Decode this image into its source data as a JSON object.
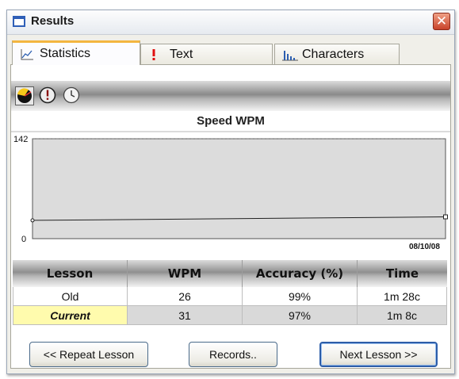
{
  "window": {
    "title": "Results",
    "close_glyph": "✕"
  },
  "tabs": [
    {
      "label": "Statistics",
      "icon": "line-chart-icon",
      "active": true
    },
    {
      "label": "Text",
      "icon": "exclamation-icon",
      "active": false
    },
    {
      "label": "Characters",
      "icon": "bar-chart-icon",
      "active": false
    }
  ],
  "toolbar": [
    {
      "icon": "speed-gauge-icon",
      "active": true
    },
    {
      "icon": "accuracy-warning-icon",
      "active": false
    },
    {
      "icon": "clock-icon",
      "active": false
    }
  ],
  "chart_data": {
    "type": "line",
    "title": "Speed WPM",
    "ylim": [
      0,
      142
    ],
    "ytick_labels": [
      "142",
      "0"
    ],
    "x_label_right": "08/10/08",
    "series": [
      {
        "values": [
          26,
          31
        ]
      }
    ]
  },
  "table": {
    "headers": [
      "Lesson",
      "WPM",
      "Accuracy (%)",
      "Time"
    ],
    "rows": [
      [
        "Old",
        "26",
        "99%",
        "1m 28c"
      ],
      [
        "Current",
        "31",
        "97%",
        "1m 8c"
      ]
    ]
  },
  "buttons": {
    "repeat": "<< Repeat Lesson",
    "records": "Records..",
    "next": "Next Lesson >>"
  },
  "colors": {
    "accent_tab": "#f3b640",
    "current_highlight": "#fffbad",
    "close_red": "#c8432a"
  }
}
